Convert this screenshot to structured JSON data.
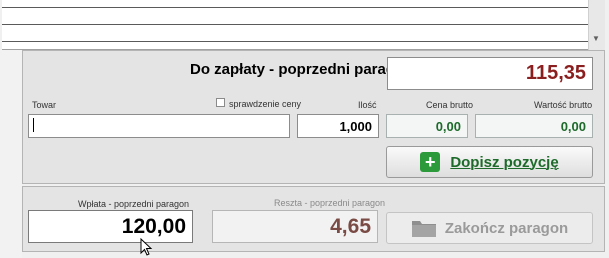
{
  "list": {
    "rows": 3
  },
  "to_pay": {
    "label": "Do zapłaty - poprzedni paragon",
    "value": "115,35",
    "value_color": "#8b1e1e"
  },
  "entry": {
    "product_label": "Towar",
    "product_value": "",
    "price_check_label": "sprawdzenie ceny",
    "price_check_checked": false,
    "quantity_label": "Ilość",
    "quantity_value": "1,000",
    "gross_price_label": "Cena brutto",
    "gross_price_value": "0,00",
    "gross_value_label": "Wartość brutto",
    "gross_value_value": "0,00"
  },
  "add_button": {
    "label": "Dopisz pozycję",
    "icon": "plus-icon"
  },
  "payment": {
    "paid_label": "Wpłata - poprzedni paragon",
    "paid_value": "120,00",
    "change_label": "Reszta - poprzedni paragon",
    "change_value": "4,65"
  },
  "finish_button": {
    "label": "Zakończ paragon",
    "icon": "folder-icon",
    "enabled": false
  },
  "colors": {
    "accent_green": "#1d6a2a",
    "amount_red": "#8b1e1e"
  }
}
